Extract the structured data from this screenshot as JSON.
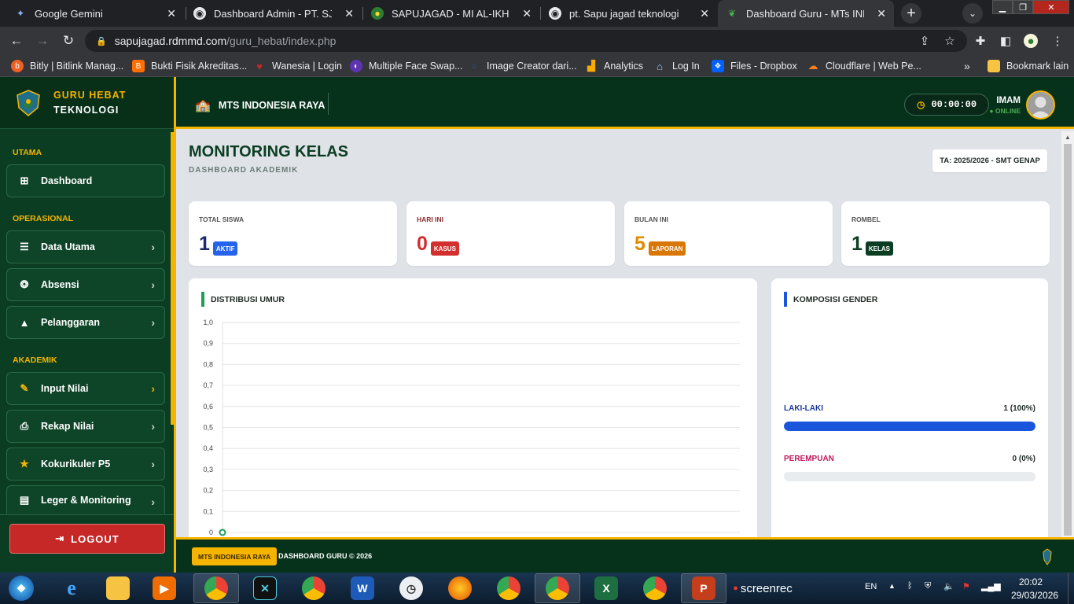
{
  "browser": {
    "tabs": [
      {
        "label": "Google Gemini",
        "icon": "gemini-icon"
      },
      {
        "label": "Dashboard Admin - PT. SJT",
        "icon": "globe-icon"
      },
      {
        "label": "SAPUJAGAD - MI AL-IKHLAS B",
        "icon": "school-icon"
      },
      {
        "label": "pt. Sapu jagad teknologi",
        "icon": "globe-icon"
      },
      {
        "label": "Dashboard Guru - MTs INDON",
        "icon": "guru-hebat-icon",
        "active": true
      }
    ],
    "url_host": "sapujagad.rdmmd.com",
    "url_path": "/guru_hebat/index.php",
    "bookmarks": [
      {
        "label": "Bitly | Bitlink Manag...",
        "color": "#ee6123"
      },
      {
        "label": "Bukti Fisik Akreditas...",
        "color": "#ff6f00"
      },
      {
        "label": "Wanesia | Login",
        "color": "#c62828"
      },
      {
        "label": "Multiple Face Swap...",
        "color": "#5e35b1"
      },
      {
        "label": "Image Creator dari...",
        "color": "#1565c0"
      },
      {
        "label": "Analytics",
        "color": "#f9ab00"
      },
      {
        "label": "Log In",
        "color": "#90caf9"
      },
      {
        "label": "Files - Dropbox",
        "color": "#0061fe"
      },
      {
        "label": "Cloudflare | Web Pe...",
        "color": "#f38020"
      }
    ],
    "bookmark_other": "Bookmark lain"
  },
  "app": {
    "brand": {
      "line1": "GURU HEBAT",
      "line2": "TEKNOLOGI"
    },
    "school_name": "MTS INDONESIA RAYA",
    "timer": "00:00:00",
    "user": {
      "name": "IMAM",
      "status": "ONLINE"
    },
    "sidebar": {
      "sections": [
        "UTAMA",
        "OPERASIONAL",
        "AKADEMIK"
      ],
      "items": [
        {
          "label": "Dashboard",
          "icon": "grid-icon"
        },
        {
          "label": "Data Utama",
          "icon": "database-icon"
        },
        {
          "label": "Absensi",
          "icon": "fingerprint-icon"
        },
        {
          "label": "Pelanggaran",
          "icon": "warning-icon"
        },
        {
          "label": "Input Nilai",
          "icon": "edit-icon"
        },
        {
          "label": "Rekap Nilai",
          "icon": "print-icon"
        },
        {
          "label": "Kokurikuler P5",
          "icon": "star-icon"
        },
        {
          "label": "Leger & Monitoring",
          "icon": "file-icon"
        }
      ],
      "logout": "LOGOUT"
    },
    "page": {
      "title": "MONITORING KELAS",
      "subtitle": "DASHBOARD AKADEMIK",
      "academic_year": "TA: 2025/2026 - SMT GENAP"
    },
    "stats": [
      {
        "label": "TOTAL SISWA",
        "value": "1",
        "badge": "AKTIF",
        "color": "#1a2a6c",
        "badge_color": "#2563eb",
        "label_color": "#555"
      },
      {
        "label": "HARI INI",
        "value": "0",
        "badge": "KASUS",
        "color": "#d32f2f",
        "badge_color": "#d32f2f",
        "label_color": "#8a2c2c"
      },
      {
        "label": "BULAN INI",
        "value": "5",
        "badge": "LAPORAN",
        "color": "#e08a00",
        "badge_color": "#d97706",
        "label_color": "#555"
      },
      {
        "label": "ROMBEL",
        "value": "1",
        "badge": "KELAS",
        "color": "#0b3d22",
        "badge_color": "#0b3d22",
        "label_color": "#555"
      }
    ],
    "age_chart": {
      "title": "DISTRIBUSI UMUR"
    },
    "gender": {
      "title": "KOMPOSISI GENDER",
      "rows": [
        {
          "label": "LAKI-LAKI",
          "value": "1 (100%)",
          "fraction": 1.0,
          "color": "#1a56db",
          "label_color": "#1a3a9c"
        },
        {
          "label": "PEREMPUAN",
          "value": "0 (0%)",
          "fraction": 0.0,
          "color": "#c2185b",
          "label_color": "#c2185b"
        }
      ]
    },
    "footer": {
      "badge": "MTS INDONESIA RAYA",
      "text": "DASHBOARD GURU © 2026"
    }
  },
  "chart_data": {
    "type": "line",
    "title": "DISTRIBUSI UMUR",
    "y_ticks": [
      "1,0",
      "0,9",
      "0,8",
      "0,7",
      "0,6",
      "0,5",
      "0,4",
      "0,3",
      "0,2",
      "0,1",
      "0"
    ],
    "ylim": [
      0,
      1
    ],
    "series": [
      {
        "values": [
          0
        ]
      }
    ],
    "grid": true
  },
  "taskbar": {
    "apps": [
      "chrome",
      "kinemaster",
      "chrome",
      "word",
      "clock",
      "firefox",
      "chrome",
      "chrome",
      "excel",
      "chrome",
      "powerpoint",
      "screenrec"
    ],
    "screenrec_label": "screenrec",
    "lang": "EN",
    "time": "20:02",
    "date": "29/03/2026"
  }
}
